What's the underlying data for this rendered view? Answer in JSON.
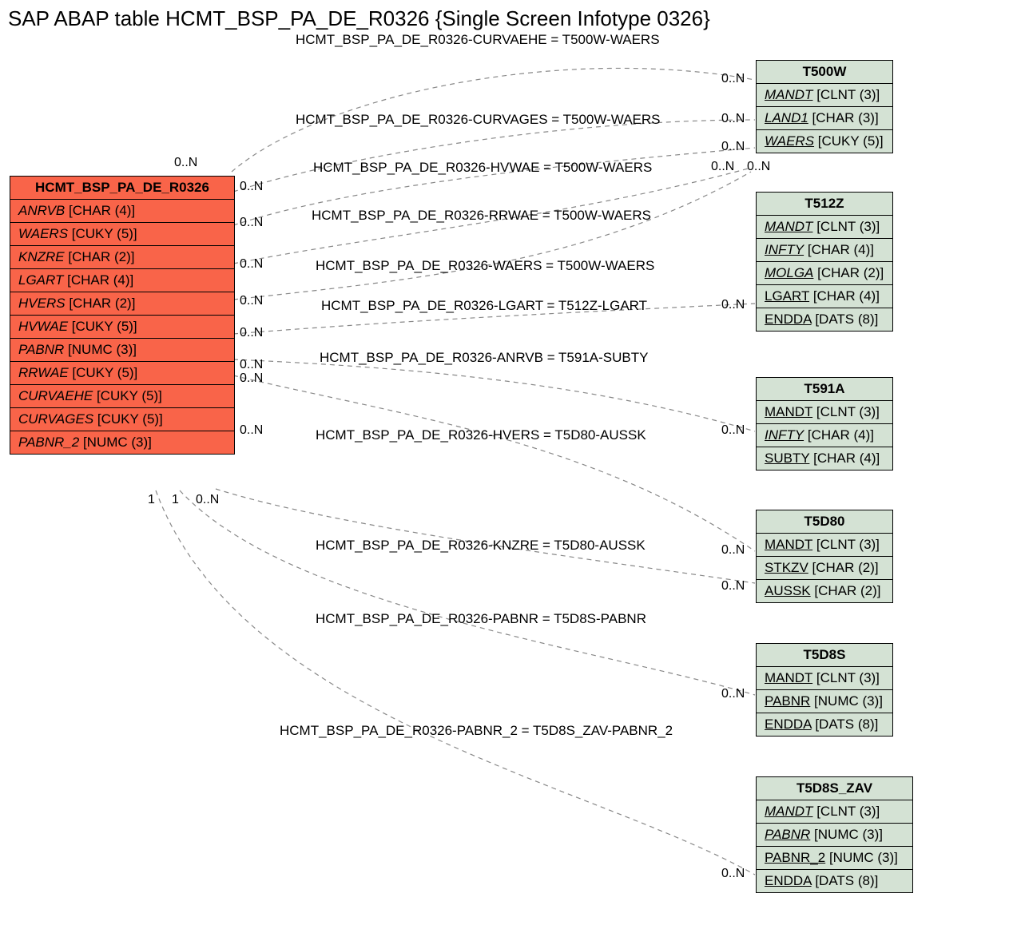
{
  "title": "SAP ABAP table HCMT_BSP_PA_DE_R0326 {Single Screen Infotype 0326}",
  "main_entity": {
    "name": "HCMT_BSP_PA_DE_R0326",
    "fields": [
      {
        "name": "ANRVB",
        "type": "[CHAR (4)]"
      },
      {
        "name": "WAERS",
        "type": "[CUKY (5)]"
      },
      {
        "name": "KNZRE",
        "type": "[CHAR (2)]"
      },
      {
        "name": "LGART",
        "type": "[CHAR (4)]"
      },
      {
        "name": "HVERS",
        "type": "[CHAR (2)]"
      },
      {
        "name": "HVWAE",
        "type": "[CUKY (5)]"
      },
      {
        "name": "PABNR",
        "type": "[NUMC (3)]"
      },
      {
        "name": "RRWAE",
        "type": "[CUKY (5)]"
      },
      {
        "name": "CURVAEHE",
        "type": "[CUKY (5)]"
      },
      {
        "name": "CURVAGES",
        "type": "[CUKY (5)]"
      },
      {
        "name": "PABNR_2",
        "type": "[NUMC (3)]"
      }
    ]
  },
  "entities": [
    {
      "id": "T500W",
      "name": "T500W",
      "fields": [
        {
          "name": "MANDT",
          "type": "[CLNT (3)]",
          "underline": true,
          "italic": true
        },
        {
          "name": "LAND1",
          "type": "[CHAR (3)]",
          "underline": true,
          "italic": true
        },
        {
          "name": "WAERS",
          "type": "[CUKY (5)]",
          "underline": true,
          "italic": true
        }
      ]
    },
    {
      "id": "T512Z",
      "name": "T512Z",
      "fields": [
        {
          "name": "MANDT",
          "type": "[CLNT (3)]",
          "underline": true,
          "italic": true
        },
        {
          "name": "INFTY",
          "type": "[CHAR (4)]",
          "underline": true,
          "italic": true
        },
        {
          "name": "MOLGA",
          "type": "[CHAR (2)]",
          "underline": true,
          "italic": true
        },
        {
          "name": "LGART",
          "type": "[CHAR (4)]",
          "underline": true,
          "italic": false
        },
        {
          "name": "ENDDA",
          "type": "[DATS (8)]",
          "underline": true,
          "italic": false
        }
      ]
    },
    {
      "id": "T591A",
      "name": "T591A",
      "fields": [
        {
          "name": "MANDT",
          "type": "[CLNT (3)]",
          "underline": true,
          "italic": false
        },
        {
          "name": "INFTY",
          "type": "[CHAR (4)]",
          "underline": true,
          "italic": true
        },
        {
          "name": "SUBTY",
          "type": "[CHAR (4)]",
          "underline": true,
          "italic": false
        }
      ]
    },
    {
      "id": "T5D80",
      "name": "T5D80",
      "fields": [
        {
          "name": "MANDT",
          "type": "[CLNT (3)]",
          "underline": true,
          "italic": false
        },
        {
          "name": "STKZV",
          "type": "[CHAR (2)]",
          "underline": true,
          "italic": false
        },
        {
          "name": "AUSSK",
          "type": "[CHAR (2)]",
          "underline": true,
          "italic": false
        }
      ]
    },
    {
      "id": "T5D8S",
      "name": "T5D8S",
      "fields": [
        {
          "name": "MANDT",
          "type": "[CLNT (3)]",
          "underline": true,
          "italic": false
        },
        {
          "name": "PABNR",
          "type": "[NUMC (3)]",
          "underline": true,
          "italic": false
        },
        {
          "name": "ENDDA",
          "type": "[DATS (8)]",
          "underline": true,
          "italic": false
        }
      ]
    },
    {
      "id": "T5D8S_ZAV",
      "name": "T5D8S_ZAV",
      "fields": [
        {
          "name": "MANDT",
          "type": "[CLNT (3)]",
          "underline": true,
          "italic": true
        },
        {
          "name": "PABNR",
          "type": "[NUMC (3)]",
          "underline": true,
          "italic": true
        },
        {
          "name": "PABNR_2",
          "type": "[NUMC (3)]",
          "underline": true,
          "italic": false
        },
        {
          "name": "ENDDA",
          "type": "[DATS (8)]",
          "underline": true,
          "italic": false
        }
      ]
    }
  ],
  "relations": [
    {
      "label": "HCMT_BSP_PA_DE_R0326-CURVAEHE = T500W-WAERS"
    },
    {
      "label": "HCMT_BSP_PA_DE_R0326-CURVAGES = T500W-WAERS"
    },
    {
      "label": "HCMT_BSP_PA_DE_R0326-HVWAE = T500W-WAERS"
    },
    {
      "label": "HCMT_BSP_PA_DE_R0326-RRWAE = T500W-WAERS"
    },
    {
      "label": "HCMT_BSP_PA_DE_R0326-WAERS = T500W-WAERS"
    },
    {
      "label": "HCMT_BSP_PA_DE_R0326-LGART = T512Z-LGART"
    },
    {
      "label": "HCMT_BSP_PA_DE_R0326-ANRVB = T591A-SUBTY"
    },
    {
      "label": "HCMT_BSP_PA_DE_R0326-HVERS = T5D80-AUSSK"
    },
    {
      "label": "HCMT_BSP_PA_DE_R0326-KNZRE = T5D80-AUSSK"
    },
    {
      "label": "HCMT_BSP_PA_DE_R0326-PABNR = T5D8S-PABNR"
    },
    {
      "label": "HCMT_BSP_PA_DE_R0326-PABNR_2 = T5D8S_ZAV-PABNR_2"
    }
  ],
  "cards": {
    "zeroN": "0..N",
    "one": "1"
  }
}
